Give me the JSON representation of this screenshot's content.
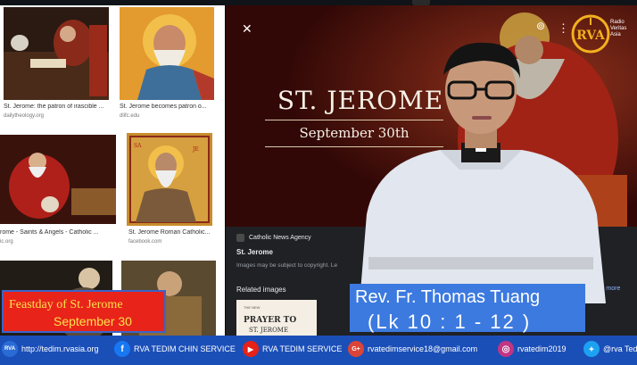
{
  "grid": {
    "items": [
      {
        "caption": "St. Jerome: the patron of irascible ...",
        "source": "dailytheology.org"
      },
      {
        "caption": "St. Jerome becomes patron o...",
        "source": "dlifc.edu"
      },
      {
        "caption": "rome - Saints & Angels - Catholic ...",
        "source": "ic.org"
      },
      {
        "caption": "St. Jerome Roman Catholic...",
        "source": "facebook.com"
      }
    ],
    "icon_label": "SAINT JEROME"
  },
  "preview": {
    "hero_title": "ST. JEROME",
    "hero_date": "September 30th",
    "source_name": "Catholic News Agency",
    "title": "St. Jerome",
    "notice": "Images may be subject to copyright. Le",
    "related_label": "Related images",
    "see_more": "See more",
    "related_item": {
      "small": "THE NEW",
      "title": "PRAYER TO",
      "subtitle": "ST. JEROME"
    }
  },
  "logo": {
    "letters": "RVA",
    "side_text": "Radio Veritas Asia"
  },
  "overlay": {
    "feast_line1": "Feastday of St. Jerome",
    "feast_line2": "September 30",
    "speaker": "Rev. Fr. Thomas Tuang",
    "reading": "(Lk 10 : 1 - 12 )"
  },
  "footer": {
    "items": [
      {
        "icon": "globe-icon",
        "text": "http://tedim.rvasia.org",
        "color": "#2a6bd6",
        "glyph": "RVA"
      },
      {
        "icon": "facebook-icon",
        "text": "RVA TEDIM CHIN SERVICE",
        "color": "#1877f2",
        "glyph": "f"
      },
      {
        "icon": "youtube-icon",
        "text": "RVA TEDIM SERVICE",
        "color": "#e62117",
        "glyph": "▶"
      },
      {
        "icon": "google-plus-icon",
        "text": "rvatedimservice18@gmail.com",
        "color": "#db4437",
        "glyph": "G+"
      },
      {
        "icon": "instagram-icon",
        "text": "rvatedim2019",
        "color": "#c13584",
        "glyph": "◎"
      },
      {
        "icon": "twitter-icon",
        "text": "@rva Tedi",
        "color": "#1da1f2",
        "glyph": "🐦"
      }
    ]
  },
  "colors": {
    "footer_bg": "#1b4fb8",
    "feast_bg": "#e8231a",
    "feast_text": "#fbe24a",
    "name_bg": "#3c7ae0"
  }
}
